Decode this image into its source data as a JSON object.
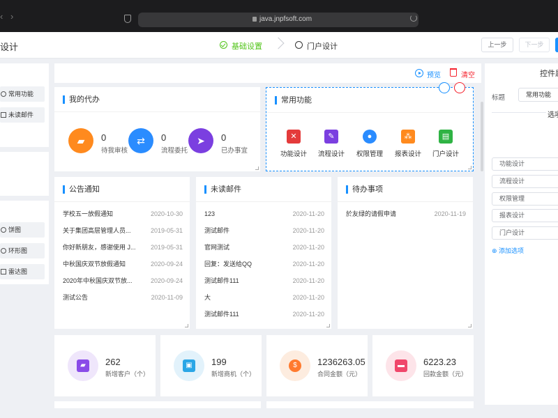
{
  "browser": {
    "url": "java.jnpfsoft.com"
  },
  "header": {
    "title": "设计",
    "steps": [
      {
        "label": "基础设置",
        "status": "done"
      },
      {
        "label": "门户设计",
        "status": "current"
      }
    ],
    "prev_label": "上一步",
    "next_label": "下一步"
  },
  "left_panel": {
    "group1": [
      "常用功能",
      "未读邮件"
    ],
    "group2": [
      "饼图",
      "环形图",
      "雷达图"
    ]
  },
  "toolbar": {
    "preview_label": "预览",
    "clear_label": "清空"
  },
  "todo_card": {
    "title": "我的代办",
    "items": [
      {
        "count": "0",
        "label": "待我审核",
        "icon": "stamp-icon",
        "color": "#ff8a1e"
      },
      {
        "count": "0",
        "label": "流程委托",
        "icon": "handshake-icon",
        "color": "#2a8cff"
      },
      {
        "count": "0",
        "label": "已办事宜",
        "icon": "paper-plane-icon",
        "color": "#7b3fe0"
      }
    ]
  },
  "common_card": {
    "title": "常用功能",
    "items": [
      {
        "label": "功能设计",
        "icon": "function-design-icon",
        "color": "#e43b3b"
      },
      {
        "label": "流程设计",
        "icon": "pencil-icon",
        "color": "#7b3fe0"
      },
      {
        "label": "权限管理",
        "icon": "user-key-icon",
        "color": "#2a8cff"
      },
      {
        "label": "报表设计",
        "icon": "org-chart-icon",
        "color": "#ff8a1e"
      },
      {
        "label": "门户设计",
        "icon": "portal-card-icon",
        "color": "#2fb344"
      }
    ]
  },
  "notice_card": {
    "title": "公告通知",
    "rows": [
      {
        "text": "学校五一放假通知",
        "date": "2020-10-30"
      },
      {
        "text": "关于集团高层管理人员...",
        "date": "2019-05-31"
      },
      {
        "text": "你好新朋友，感谢使用 J...",
        "date": "2019-05-31"
      },
      {
        "text": "中秋国庆双节放假通知",
        "date": "2020-09-24"
      },
      {
        "text": "2020年中秋国庆双节放...",
        "date": "2020-09-24"
      },
      {
        "text": "测试公告",
        "date": "2020-11-09"
      }
    ]
  },
  "mail_card": {
    "title": "未读邮件",
    "rows": [
      {
        "text": "123",
        "date": "2020-11-20"
      },
      {
        "text": "测试邮件",
        "date": "2020-11-20"
      },
      {
        "text": "官网测试",
        "date": "2020-11-20"
      },
      {
        "text": "回复：发送给QQ",
        "date": "2020-11-20"
      },
      {
        "text": "测试邮件111",
        "date": "2020-11-20"
      },
      {
        "text": "大",
        "date": "2020-11-20"
      },
      {
        "text": "测试邮件111",
        "date": "2020-11-20"
      }
    ]
  },
  "pending_card": {
    "title": "待办事项",
    "rows": [
      {
        "text": "於友绿的请假申请",
        "date": "2020-11-19"
      }
    ]
  },
  "stats": [
    {
      "value": "262",
      "label": "新增客户（个）",
      "icon": "stamp-icon",
      "color": "#8a4be8",
      "bg": "#efe6fb"
    },
    {
      "value": "199",
      "label": "新增商机（个）",
      "icon": "toolbox-icon",
      "color": "#2aa6e6",
      "bg": "#e2f2fb"
    },
    {
      "value": "1236263.05",
      "label": "合同金额（元）",
      "icon": "dollar-icon",
      "color": "#ff7a2e",
      "bg": "#fdecdf"
    },
    {
      "value": "6223.23",
      "label": "回款金额（元）",
      "icon": "payment-icon",
      "color": "#f0476b",
      "bg": "#fde4e9"
    }
  ],
  "right_panel": {
    "title": "控件属",
    "field_label": "标题",
    "field_value": "常用功能",
    "section": "选项",
    "options": [
      "功能设计",
      "流程设计",
      "权限管理",
      "报表设计",
      "门户设计"
    ],
    "add_label": "添加选项"
  }
}
